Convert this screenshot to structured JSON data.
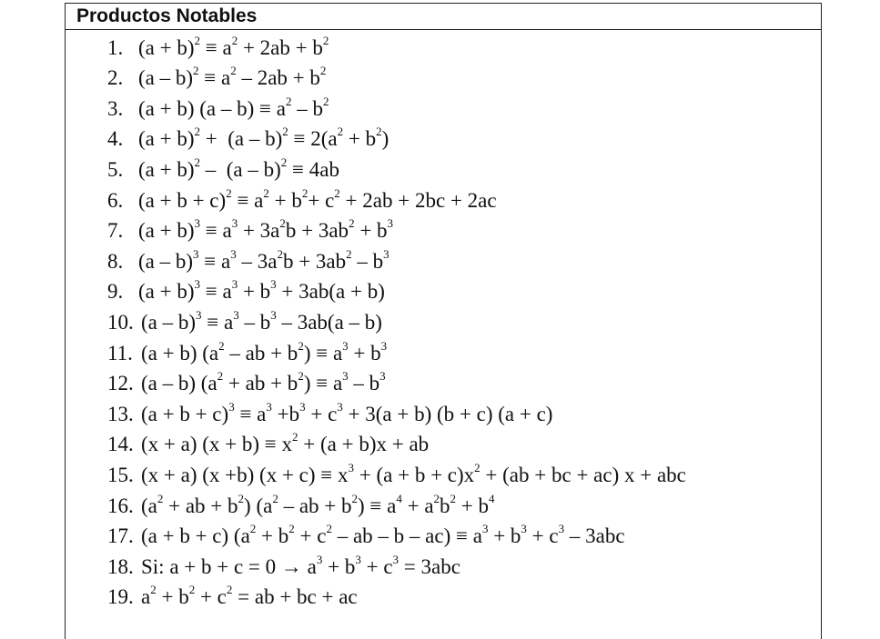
{
  "header": {
    "title": "Productos Notables"
  },
  "formulas": [
    {
      "num": "1.",
      "html": "(a + b)<sup>2</sup> ≡ a<sup>2</sup> + 2ab + b<sup>2</sup>"
    },
    {
      "num": "2.",
      "html": "(a – b)<sup>2</sup> ≡ a<sup>2</sup> – 2ab + b<sup>2</sup>"
    },
    {
      "num": "3.",
      "html": "(a + b) (a – b) ≡ a<sup>2</sup> – b<sup>2</sup>"
    },
    {
      "num": "4.",
      "html": "(a + b)<sup>2</sup> + &nbsp;(a – b)<sup>2</sup> ≡ 2(a<sup>2</sup> + b<sup>2</sup>)"
    },
    {
      "num": "5.",
      "html": "(a + b)<sup>2</sup> – &nbsp;(a – b)<sup>2</sup> ≡ 4ab"
    },
    {
      "num": "6.",
      "html": "(a + b + c)<sup>2</sup> ≡ a<sup>2</sup> + b<sup>2</sup>+ c<sup>2</sup> + 2ab + 2bc + 2ac"
    },
    {
      "num": "7.",
      "html": "(a + b)<sup>3</sup> ≡ a<sup>3</sup> + 3a<sup>2</sup>b + 3ab<sup>2</sup> + b<sup>3</sup>"
    },
    {
      "num": "8.",
      "html": "(a – b)<sup>3</sup> ≡ a<sup>3</sup> – 3a<sup>2</sup>b + 3ab<sup>2</sup> – b<sup>3</sup>"
    },
    {
      "num": "9.",
      "html": "(a + b)<sup>3</sup> ≡ a<sup>3</sup> + b<sup>3</sup> + 3ab(a + b)"
    },
    {
      "num": "10.",
      "html": "(a – b)<sup>3</sup> ≡ a<sup>3</sup> – b<sup>3</sup> – 3ab(a – b)"
    },
    {
      "num": "11.",
      "html": "(a + b) (a<sup>2</sup> – ab + b<sup>2</sup>) ≡ a<sup>3</sup> + b<sup>3</sup>"
    },
    {
      "num": "12.",
      "html": "(a – b) (a<sup>2</sup> + ab + b<sup>2</sup>) ≡ a<sup>3</sup> – b<sup>3</sup>"
    },
    {
      "num": "13.",
      "html": "(a + b + c)<sup>3</sup> ≡ a<sup>3</sup> +b<sup>3</sup> + c<sup>3</sup> + 3(a + b) (b + c) (a + c)"
    },
    {
      "num": "14.",
      "html": "(x + a) (x + b) ≡ x<sup>2</sup> + (a + b)x + ab"
    },
    {
      "num": "15.",
      "html": "(x + a) (x +b) (x + c) ≡ x<sup>3</sup> + (a + b + c)x<sup>2</sup> + (ab + bc + ac) x + abc"
    },
    {
      "num": "16.",
      "html": "(a<sup>2</sup> + ab + b<sup>2</sup>) (a<sup>2</sup> – ab + b<sup>2</sup>) ≡ a<sup>4</sup> + a<sup>2</sup>b<sup>2</sup> + b<sup>4</sup>"
    },
    {
      "num": "17.",
      "html": "(a + b + c) (a<sup>2</sup> + b<sup>2</sup> + c<sup>2</sup> – ab – b – ac) ≡ a<sup>3</sup> + b<sup>3</sup> + c<sup>3</sup> – 3abc"
    },
    {
      "num": "18.",
      "html": "Si: a + b + c = 0 → a<sup>3</sup> + b<sup>3</sup> + c<sup>3</sup> = 3abc"
    },
    {
      "num": "19.",
      "html": "a<sup>2</sup> + b<sup>2</sup> + c<sup>2</sup> = ab + bc + ac"
    }
  ]
}
